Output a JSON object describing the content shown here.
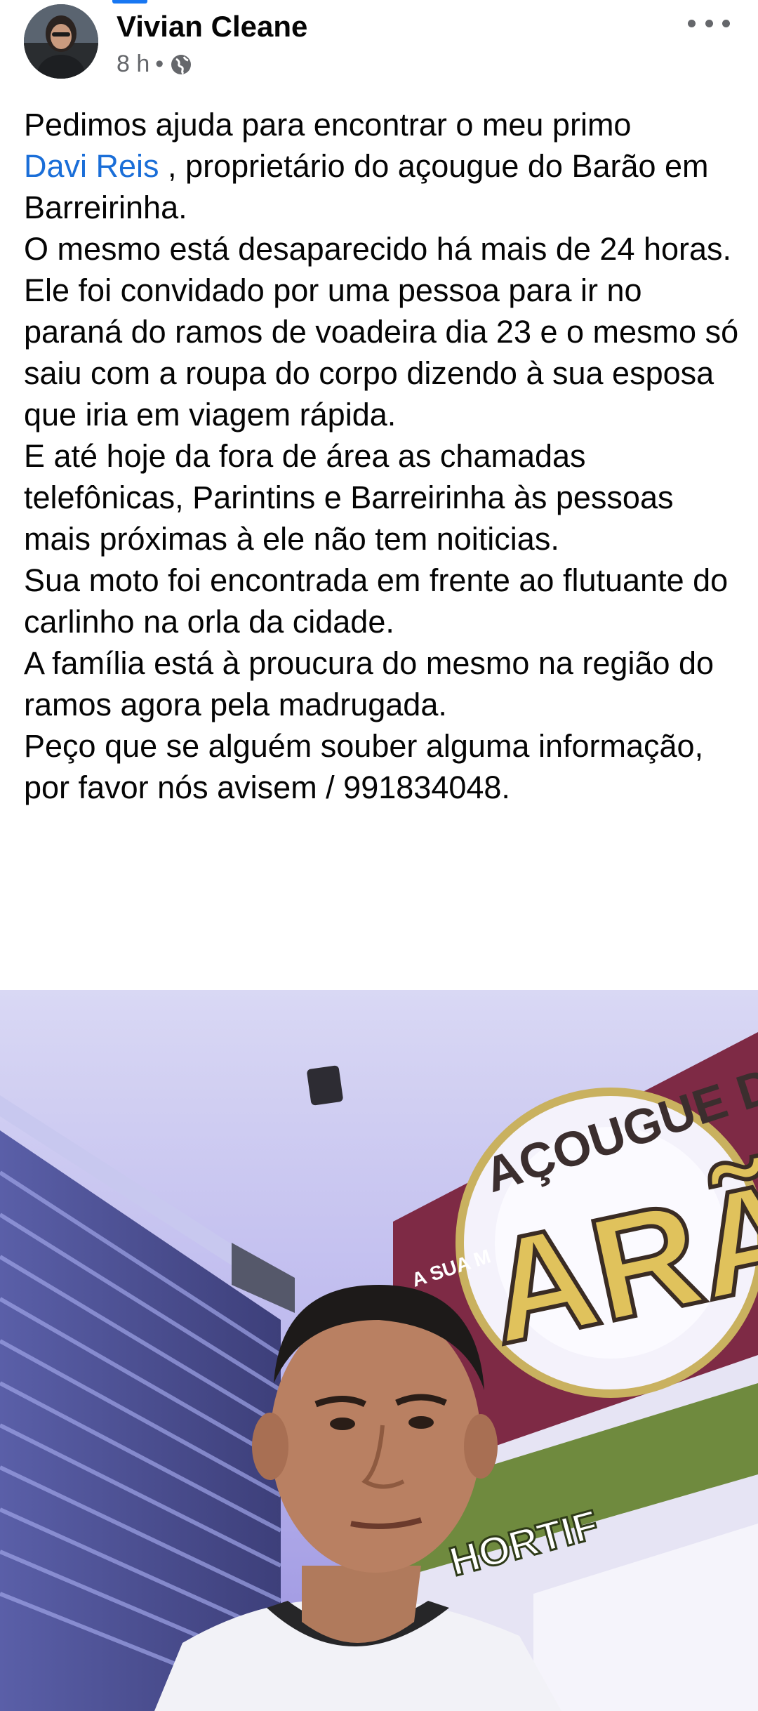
{
  "post": {
    "author": "Vivian Cleane",
    "time": "8 h",
    "separator": "•",
    "privacy_icon": "globe-icon",
    "more_icon": "more-dots-icon",
    "text": {
      "p1_before": "Pedimos ajuda para encontrar o meu primo",
      "mention": "Davi Reis",
      "p1_after": " , proprietário do açougue do Barão em Barreirinha.",
      "p2": "O mesmo está desaparecido há mais de 24 horas.",
      "p3": "Ele foi convidado por uma pessoa para ir no paraná do ramos de voadeira dia 23 e o mesmo só saiu com a roupa do corpo dizendo à sua esposa que iria em viagem rápida.",
      "p4": "E até hoje da fora de área as chamadas telefônicas, Parintins e Barreirinha às pessoas mais próximas à ele não tem noiticias.",
      "p5": "Sua moto foi encontrada em frente ao flutuante do carlinho na orla da cidade.",
      "p6": "A família está à proucura do mesmo na região do ramos agora pela madrugada.",
      "p7": "Peço que se alguém souber alguma informação, por favor nós avisem / 991834048."
    },
    "photo_sign": {
      "arc_text": "AÇOUGUE DO",
      "big_text": "ARÃ",
      "bottom_text": "HORTIF",
      "small_text": "A SUA M"
    },
    "colors": {
      "mention": "#1a6ed8",
      "accent": "#1877f2",
      "meta": "#65676b"
    }
  }
}
